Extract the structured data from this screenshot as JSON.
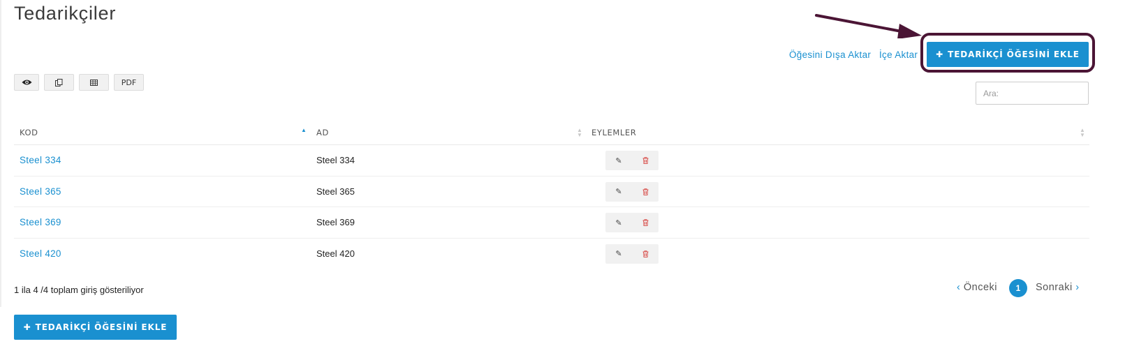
{
  "page": {
    "title": "Tedarikçiler"
  },
  "top_links": {
    "export": "Öğesini Dışa Aktar",
    "import": "İçe Aktar"
  },
  "add_button": {
    "icon": "plus-icon",
    "label": "TEDARİKÇİ ÖĞESİNİ EKLE"
  },
  "export_buttons": {
    "pdf_label": "PDF"
  },
  "search": {
    "placeholder": "Ara:"
  },
  "table": {
    "headers": {
      "code": "KOD",
      "name": "AD",
      "actions": "EYLEMLER"
    },
    "rows": [
      {
        "code": "Steel 334",
        "name": "Steel 334"
      },
      {
        "code": "Steel 365",
        "name": "Steel 365"
      },
      {
        "code": "Steel 369",
        "name": "Steel 369"
      },
      {
        "code": "Steel 420",
        "name": "Steel 420"
      }
    ]
  },
  "info_text": "1 ila 4 /4 toplam giriş gösteriliyor",
  "pagination": {
    "prev": "Önceki",
    "current_page": "1",
    "next": "Sonraki"
  },
  "colors": {
    "accent": "#1a90d0",
    "highlight": "#4b1535",
    "delete": "#d9534f"
  }
}
